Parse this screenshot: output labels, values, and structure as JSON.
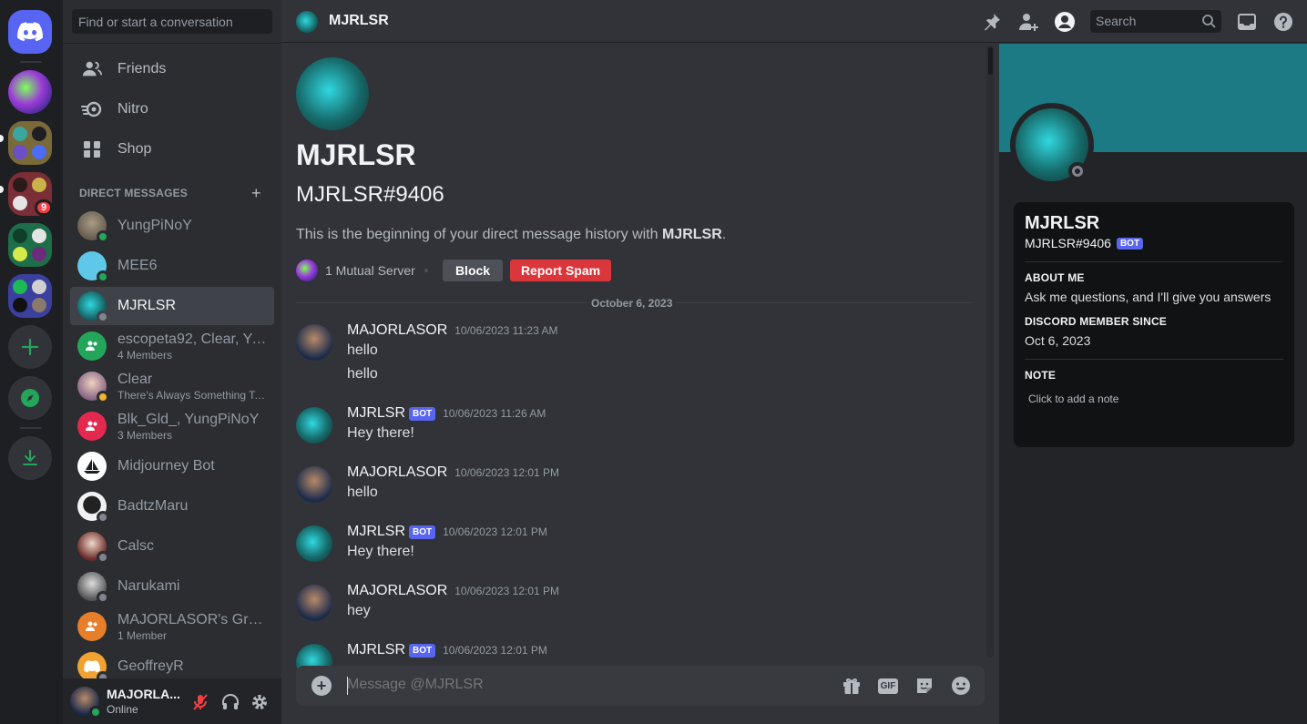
{
  "colors": {
    "blurple": "#5865f2",
    "green": "#23a55a",
    "red": "#da373c",
    "banner": "#1b7a83"
  },
  "rail": {
    "home_icon": "discord-logo-icon",
    "mention_count": "9",
    "add_server_icon": "plus-icon",
    "explore_icon": "compass-icon",
    "download_icon": "download-icon"
  },
  "sidebar": {
    "search_placeholder": "Find or start a conversation",
    "nav": [
      {
        "label": "Friends",
        "icon": "friends-icon"
      },
      {
        "label": "Nitro",
        "icon": "nitro-icon"
      },
      {
        "label": "Shop",
        "icon": "shop-icon"
      }
    ],
    "dm_header": "DIRECT MESSAGES",
    "dms": [
      {
        "name": "YungPiNoY",
        "sub": "",
        "status": "online"
      },
      {
        "name": "MEE6",
        "sub": "",
        "status": "online"
      },
      {
        "name": "MJRLSR",
        "sub": "",
        "status": "offline"
      },
      {
        "name": "escopeta92, Clear, Yu...",
        "sub": "4 Members",
        "status": "group"
      },
      {
        "name": "Clear",
        "sub": "There's Always Something To ...",
        "status": "idle"
      },
      {
        "name": "Blk_Gld_, YungPiNoY",
        "sub": "3 Members",
        "status": "group"
      },
      {
        "name": "Midjourney Bot",
        "sub": "",
        "status": "none"
      },
      {
        "name": "BadtzMaru",
        "sub": "",
        "status": "offline"
      },
      {
        "name": "Calsc",
        "sub": "",
        "status": "offline"
      },
      {
        "name": "Narukami",
        "sub": "",
        "status": "offline"
      },
      {
        "name": "MAJORLASOR's Group",
        "sub": "1 Member",
        "status": "group"
      },
      {
        "name": "GeoffreyR",
        "sub": "",
        "status": "offline"
      }
    ]
  },
  "user_panel": {
    "name": "MAJORLA...",
    "status": "Online"
  },
  "topbar": {
    "title": "MJRLSR",
    "search_placeholder": "Search"
  },
  "intro": {
    "name": "MJRLSR",
    "tag": "MJRLSR#9406",
    "begin_prefix": "This is the beginning of your direct message history with ",
    "begin_name": "MJRLSR",
    "begin_suffix": ".",
    "mutual": "1 Mutual Server",
    "block": "Block",
    "report": "Report Spam",
    "date": "October 6, 2023"
  },
  "messages": [
    {
      "author": "MAJORLASOR",
      "bot": false,
      "time": "10/06/2023 11:23 AM",
      "lines": [
        "hello",
        "hello"
      ]
    },
    {
      "author": "MJRLSR",
      "bot": true,
      "time": "10/06/2023 11:26 AM",
      "lines": [
        "Hey there!"
      ]
    },
    {
      "author": "MAJORLASOR",
      "bot": false,
      "time": "10/06/2023 12:01 PM",
      "lines": [
        "hello"
      ]
    },
    {
      "author": "MJRLSR",
      "bot": true,
      "time": "10/06/2023 12:01 PM",
      "lines": [
        "Hey there!"
      ]
    },
    {
      "author": "MAJORLASOR",
      "bot": false,
      "time": "10/06/2023 12:01 PM",
      "lines": [
        "hey"
      ]
    },
    {
      "author": "MJRLSR",
      "bot": true,
      "time": "10/06/2023 12:01 PM",
      "lines": []
    }
  ],
  "bot_badge": "BOT",
  "composer": {
    "placeholder": "Message @MJRLSR",
    "gif": "GIF"
  },
  "profile": {
    "name": "MJRLSR",
    "tag": "MJRLSR#9406",
    "about_h": "ABOUT ME",
    "about_v": "Ask me questions, and I'll give you answers",
    "since_h": "DISCORD MEMBER SINCE",
    "since_v": "Oct 6, 2023",
    "note_h": "NOTE",
    "note_v": "Click to add a note"
  }
}
